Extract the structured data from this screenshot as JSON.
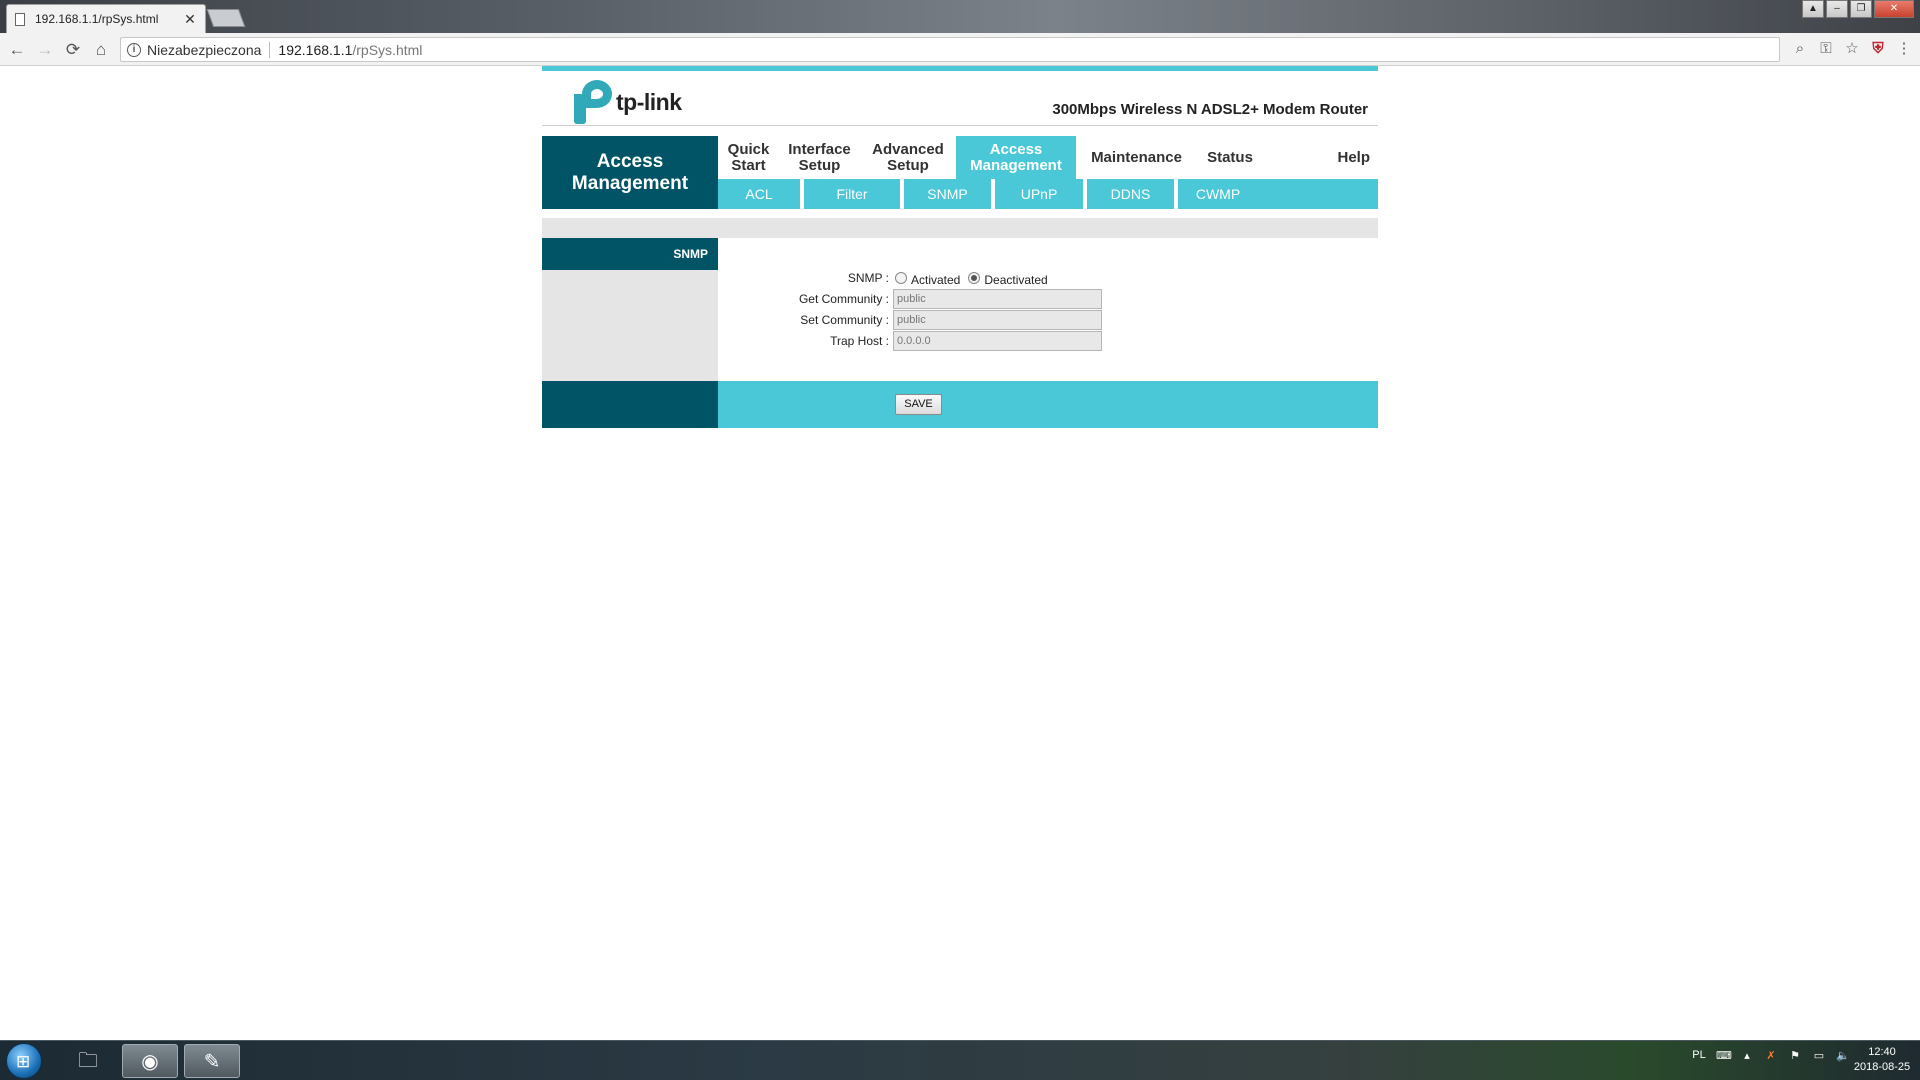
{
  "browser": {
    "tab_title": "192.168.1.1/rpSys.html",
    "tab_close": "✕",
    "nav": {
      "back": "←",
      "forward": "→",
      "reload": "⟳",
      "home": "⌂"
    },
    "security_label": "Niezabezpieczona",
    "url_host": "192.168.1.1",
    "url_path": "/rpSys.html",
    "icons": [
      "zoom-icon",
      "key-icon",
      "star-icon",
      "shield-icon",
      "menu-icon"
    ]
  },
  "router": {
    "brand": "tp-link",
    "model": "300Mbps Wireless N ADSL2+ Modem Router",
    "section_title_line1": "Access",
    "section_title_line2": "Management",
    "main_menu": [
      {
        "line1": "Quick",
        "line2": "Start"
      },
      {
        "line1": "Interface",
        "line2": "Setup"
      },
      {
        "line1": "Advanced",
        "line2": "Setup"
      },
      {
        "line1": "Access",
        "line2": "Management"
      },
      {
        "line1": "Maintenance",
        "line2": ""
      },
      {
        "line1": "Status",
        "line2": ""
      },
      {
        "line1": "Help",
        "line2": ""
      }
    ],
    "sub_menu": [
      "ACL",
      "Filter",
      "SNMP",
      "UPnP",
      "DDNS",
      "CWMP"
    ],
    "subsection_title": "SNMP",
    "form": {
      "snmp_label": "SNMP :",
      "snmp_options": [
        "Activated",
        "Deactivated"
      ],
      "snmp_selected": "Deactivated",
      "get_community_label": "Get Community :",
      "get_community_value": "public",
      "set_community_label": "Set Community :",
      "set_community_value": "public",
      "trap_host_label": "Trap Host :",
      "trap_host_value": "0.0.0.0"
    },
    "save_label": "SAVE"
  },
  "taskbar": {
    "language": "PL",
    "time": "12:40",
    "date": "2018-08-25"
  },
  "colors": {
    "accent": "#4ac8d8",
    "dark": "#005466",
    "panel_gray": "#e5e5e5"
  }
}
